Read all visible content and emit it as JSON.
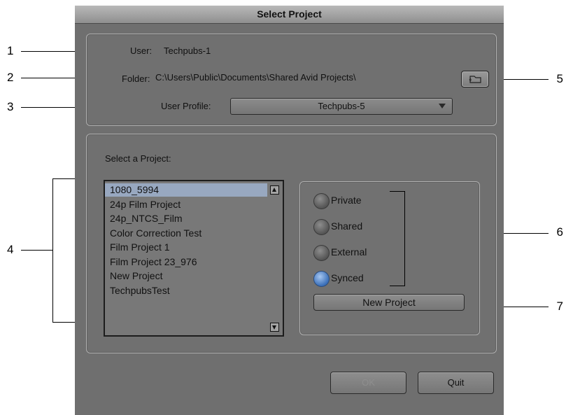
{
  "dialog": {
    "title": "Select Project",
    "user_label": "User:",
    "user_value": "Techpubs-1",
    "folder_label": "Folder:",
    "folder_value": "C:\\Users\\Public\\Documents\\Shared Avid Projects\\",
    "profile_label": "User Profile:",
    "profile_value": "Techpubs-5",
    "select_project_label": "Select a Project:",
    "projects": [
      "1080_5994",
      "24p Film Project",
      "24p_NTCS_Film",
      "Color Correction Test",
      "Film Project 1",
      "Film Project 23_976",
      "New Project",
      "TechpubsTest"
    ],
    "selected_project_index": 0,
    "location_options": [
      {
        "label": "Private",
        "selected": false
      },
      {
        "label": "Shared",
        "selected": false
      },
      {
        "label": "External",
        "selected": false
      },
      {
        "label": "Synced",
        "selected": true
      }
    ],
    "new_project_label": "New Project",
    "ok_label": "OK",
    "quit_label": "Quit"
  },
  "callouts": [
    "1",
    "2",
    "3",
    "4",
    "5",
    "6",
    "7"
  ],
  "icons": {
    "folder_browse": "folder-icon",
    "dropdown": "chevron-down-icon"
  },
  "colors": {
    "selection": "#98a8c0",
    "radio_on": "#3a6fb8",
    "panel": "#707070"
  }
}
